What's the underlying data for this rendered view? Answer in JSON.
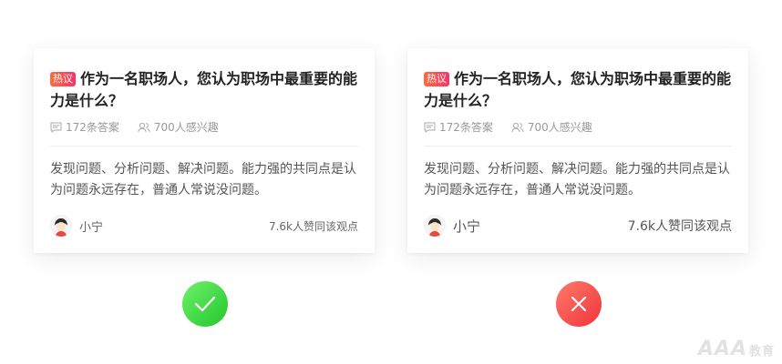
{
  "cards": [
    {
      "badge": "热议",
      "title": "作为一名职场人，您认为职场中最重要的能力是什么？",
      "answers": "172条答案",
      "interested": "700人感兴趣",
      "excerpt": "发现问题、分析问题、解决问题。能力强的共同点是认为问题永远存在，普通人常说没问题。",
      "username": "小宁",
      "likes": "7.6k人赞同该观点"
    },
    {
      "badge": "热议",
      "title": "作为一名职场人，您认为职场中最重要的能力是什么？",
      "answers": "172条答案",
      "interested": "700人感兴趣",
      "excerpt": "发现问题、分析问题、解决问题。能力强的共同点是认为问题永远存在，普通人常说没问题。",
      "username": "小宁",
      "likes": "7.6k人赞同该观点"
    }
  ],
  "marks": {
    "good_color": "#2ecc40",
    "bad_color": "#f0343b",
    "good_icon": "check-icon",
    "bad_icon": "cross-icon"
  },
  "watermark": {
    "text": "AAA",
    "sub": "教育"
  }
}
